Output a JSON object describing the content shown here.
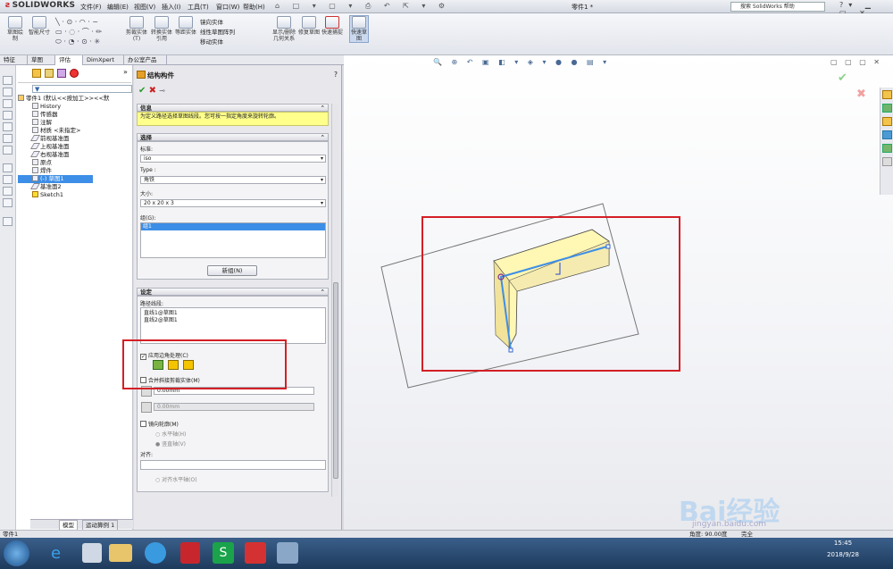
{
  "app": {
    "logo_brand": "SOLIDWORKS",
    "doc_title": "零件1 *"
  },
  "menu": [
    "文件(F)",
    "编辑(E)",
    "视图(V)",
    "插入(I)",
    "工具(T)",
    "窗口(W)",
    "帮助(H)"
  ],
  "search": {
    "placeholder": "搜索 SolidWorks 帮助"
  },
  "ribbon": {
    "buttons": [
      "草图绘制",
      "智能尺寸",
      "剪裁实体(T)",
      "转换实体引用",
      "等距实体",
      "显示/删除几何关系",
      "修复草图",
      "快速捕捉",
      "快速草图"
    ],
    "mirror": "镜向实体",
    "linear": "线性草图阵列",
    "move": "移动实体"
  },
  "tabs": [
    "特征",
    "草图",
    "评估",
    "DimXpert",
    "办公室产品"
  ],
  "tree": {
    "root": "零件1 (默认<<按加工>><<默",
    "items": [
      "History",
      "传感器",
      "注解",
      "材质 <未指定>",
      "前视基准面",
      "上视基准面",
      "右视基准面",
      "原点",
      "焊件",
      "(-) 草图1",
      "基准面2",
      "Sketch1"
    ],
    "bottom_tabs": [
      "模型",
      "运动算例 1"
    ]
  },
  "pm": {
    "title": "结构构件",
    "info_header": "信息",
    "info_text": "为定义路径选择草图线段。您可按一指定角度来旋转轮廓。",
    "select_header": "选择",
    "standard_label": "标准:",
    "standard_value": "iso",
    "type_label": "Type :",
    "type_value": "角铁",
    "size_label": "大小:",
    "size_value": "20 x 20 x 3",
    "group_label": "组(G):",
    "group_item": "组1",
    "new_group": "新组(N)",
    "settings_header": "设定",
    "path_label": "路径线段:",
    "path_items": [
      "直线1@草图1",
      "直线2@草图1"
    ],
    "apply_corner": "应用边角处理(C)",
    "merge_miter": "合并斜接剪裁实体(M)",
    "gap1": "0.00mm",
    "gap2": "0.00mm",
    "mirror_profile": "镜向轮廓(M)",
    "horizontal_axis": "水平轴(H)",
    "vertical_axis": "竖直轴(V)",
    "align_label": "对齐:",
    "align_horizontal": "对齐水平轴(O)"
  },
  "status": {
    "left": "零件1",
    "angle": "角度: 90.00度",
    "def": "完全"
  },
  "taskbar": {
    "time": "15:45",
    "date": "2018/9/28"
  },
  "watermark": {
    "site": "jingyan.baidu.com",
    "text": "Bai经验"
  },
  "colors": {
    "highlight_red": "#d41f26",
    "info_yellow": "#ffff8c",
    "select_blue": "#3d8ee6"
  }
}
